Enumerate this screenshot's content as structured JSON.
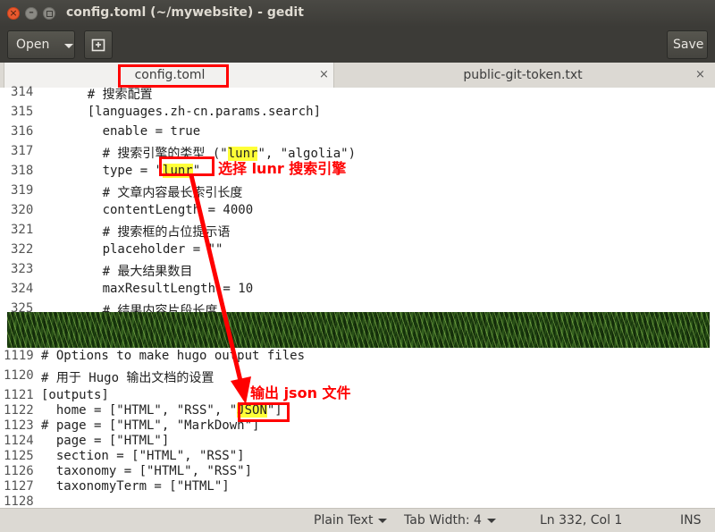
{
  "window": {
    "title": "config.toml (~/mywebsite) - gedit",
    "close_glyph": "×",
    "minimize_glyph": "–"
  },
  "toolbar": {
    "open_label": "Open",
    "save_label": "Save"
  },
  "tabs": [
    {
      "label": "config.toml",
      "close": "×",
      "active": true
    },
    {
      "label": "public-git-token.txt",
      "close": "×",
      "active": false
    }
  ],
  "top_lines": [
    {
      "num": "314",
      "code": "    # 搜索配置"
    },
    {
      "num": "315",
      "code": "    [languages.zh-cn.params.search]"
    },
    {
      "num": "316",
      "code": "      enable = true"
    },
    {
      "num": "317",
      "pre": "      # 搜索引擎的类型 (\"",
      "hl": "lunr",
      "post": "\", \"algolia\")"
    },
    {
      "num": "318",
      "pre": "      type = \"",
      "hl": "lunr",
      "post": "\""
    },
    {
      "num": "319",
      "code": "      # 文章内容最长索引长度"
    },
    {
      "num": "320",
      "code": "      contentLength = 4000"
    },
    {
      "num": "321",
      "code": "      # 搜索框的占位提示语"
    },
    {
      "num": "322",
      "code": "      placeholder = \"\""
    },
    {
      "num": "323",
      "code": "      # 最大结果数目"
    },
    {
      "num": "324",
      "code": "      maxResultLength = 10"
    },
    {
      "num": "325",
      "code": "      # 结果内容片段长度"
    }
  ],
  "bottom_lines": [
    {
      "num": "1119",
      "code": "# Options to make hugo output files"
    },
    {
      "num": "1120",
      "code": "# 用于 Hugo 输出文档的设置"
    },
    {
      "num": "1121",
      "code": "[outputs]"
    },
    {
      "num": "1122",
      "pre": "  home = [\"HTML\", \"RSS\", \"",
      "hl": "JSON",
      "post": "\"]"
    },
    {
      "num": "1123",
      "code": "# page = [\"HTML\", \"MarkDown\"]"
    },
    {
      "num": "1124",
      "code": "  page = [\"HTML\"]"
    },
    {
      "num": "1125",
      "code": "  section = [\"HTML\", \"RSS\"]"
    },
    {
      "num": "1126",
      "code": "  taxonomy = [\"HTML\", \"RSS\"]"
    },
    {
      "num": "1127",
      "code": "  taxonomyTerm = [\"HTML\"]"
    },
    {
      "num": "1128",
      "code": ""
    }
  ],
  "annotations": {
    "lunr_note": "选择 lunr 搜索引擎",
    "json_note": "输出 json 文件"
  },
  "statusbar": {
    "language": "Plain Text",
    "tab_width": "Tab Width: 4",
    "position": "Ln 332, Col 1",
    "mode": "INS"
  },
  "colors": {
    "highlight": "#ffff38",
    "annotation_red": "#ff0000",
    "titlebar": "#3c3b37"
  }
}
